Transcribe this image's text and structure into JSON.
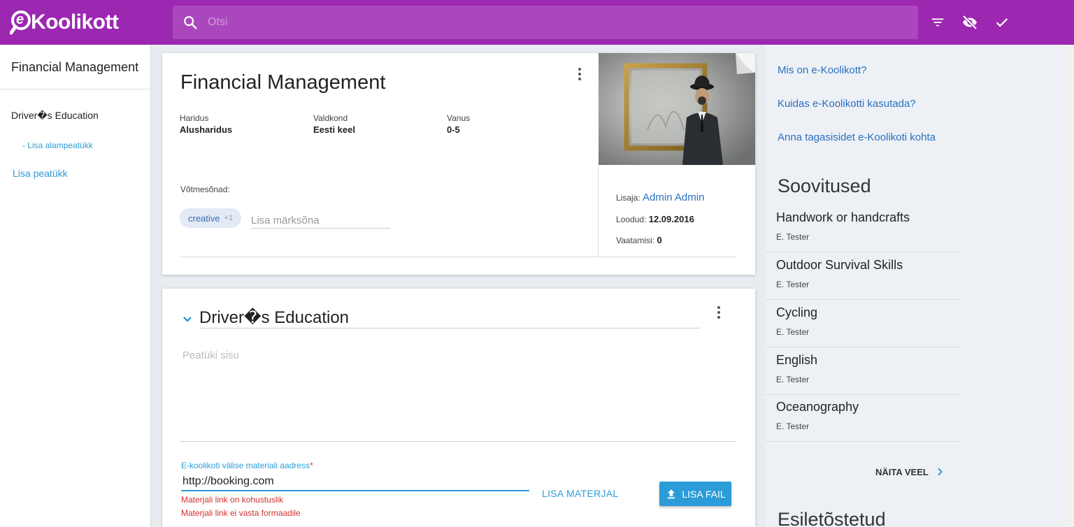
{
  "app": {
    "logo_text": "Koolikott",
    "logo_mark": "e"
  },
  "search": {
    "placeholder": "Otsi"
  },
  "toolbar": {
    "icons": [
      "search-icon",
      "filter-icon",
      "visibility-off-icon",
      "check-icon"
    ]
  },
  "sidebar": {
    "title": "Financial Management",
    "chapter": "Driver�s Education",
    "add_subchapter": "- Lisa alampeatükk",
    "add_chapter": "Lisa peatükk"
  },
  "material": {
    "title": "Financial Management",
    "meta": [
      {
        "label": "Haridus",
        "value": "Alusharidus"
      },
      {
        "label": "Valdkond",
        "value": "Eesti keel"
      },
      {
        "label": "Vanus",
        "value": "0-5"
      }
    ],
    "keywords_label": "Võtmesõnad:",
    "tag": {
      "text": "creative",
      "count": "+1"
    },
    "keyword_placeholder": "Lisa märksõna",
    "added_by_label": "Lisaja:",
    "added_by": "Admin Admin",
    "created_label": "Loodud:",
    "created": "12.09.2016",
    "views_label": "Vaatamisi:",
    "views": "0"
  },
  "chapter": {
    "title": "Driver�s Education",
    "body_placeholder": "Peatüki sisu",
    "url_label": "E-koolikoti välise materiali aadress",
    "url_required": "*",
    "url_value": "http://booking.com",
    "errors": [
      "Materjali link on kohustuslik",
      "Materjali link ei vasta formaadile"
    ],
    "add_material": "LISA MATERJAL",
    "add_file": "LISA FAIL"
  },
  "right": {
    "links": [
      "Mis on e-Koolikott?",
      "Kuidas e-Koolikotti kasutada?",
      "Anna tagasisidet e-Koolikoti kohta"
    ],
    "recommendations_title": "Soovitused",
    "recommendations": [
      {
        "title": "Handwork or handcrafts",
        "author": "E. Tester"
      },
      {
        "title": "Outdoor Survival Skills",
        "author": "E. Tester"
      },
      {
        "title": "Cycling",
        "author": "E. Tester"
      },
      {
        "title": "English",
        "author": "E. Tester"
      },
      {
        "title": "Oceanography",
        "author": "E. Tester"
      }
    ],
    "show_more": "NÄITA VEEL",
    "featured_title": "Esiletõstetud"
  },
  "colors": {
    "topbar": "#9c27b0",
    "search_bg": "#ab47bc",
    "accent": "#2b9cd8",
    "link": "#2a6fbf",
    "error": "#d32f2f"
  }
}
